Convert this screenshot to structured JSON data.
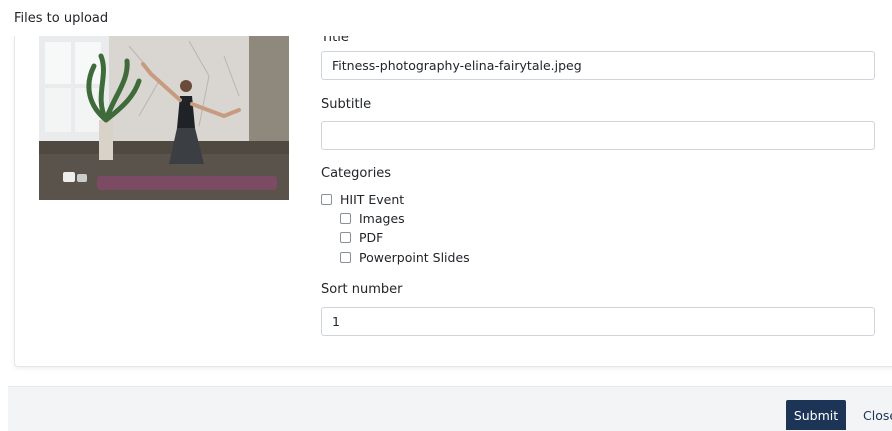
{
  "page": {
    "heading": "Files to upload"
  },
  "form": {
    "title_label": "Title",
    "title_value": "Fitness-photography-elina-fairytale.jpeg",
    "subtitle_label": "Subtitle",
    "subtitle_value": "",
    "categories_label": "Categories",
    "categories": [
      {
        "label": "HIIT Event",
        "checked": false,
        "level": 0
      },
      {
        "label": "Images",
        "checked": false,
        "level": 1
      },
      {
        "label": "PDF",
        "checked": false,
        "level": 1
      },
      {
        "label": "Powerpoint Slides",
        "checked": false,
        "level": 1
      }
    ],
    "sort_label": "Sort number",
    "sort_value": "1"
  },
  "footer": {
    "submit_label": "Submit",
    "close_label": "Close"
  },
  "colors": {
    "primary": "#1c3557",
    "border": "#ced4da",
    "footer_bg": "#f3f4f6"
  }
}
